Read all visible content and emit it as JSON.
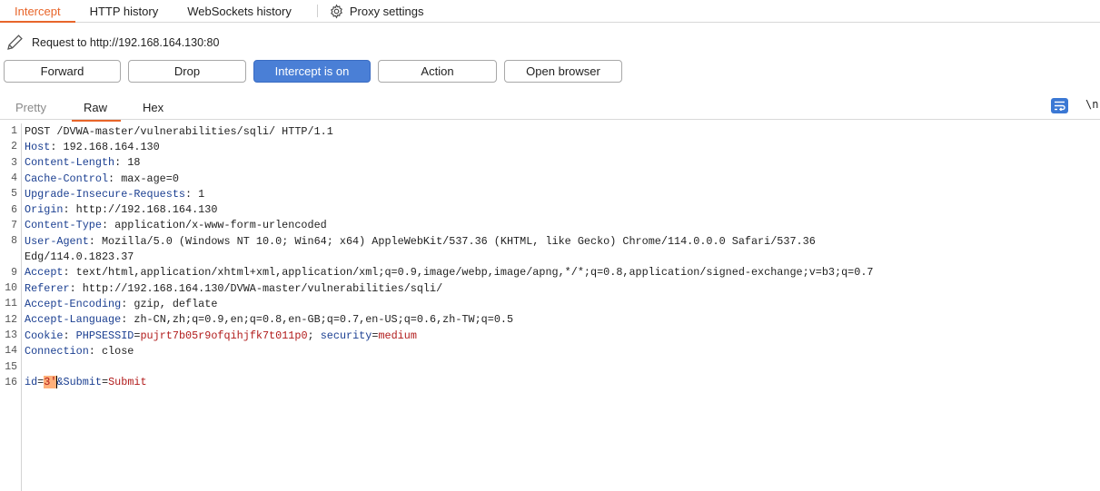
{
  "tabs": {
    "intercept": "Intercept",
    "http_history": "HTTP history",
    "websockets_history": "WebSockets history",
    "proxy_settings": "Proxy settings"
  },
  "request_to": "Request to http://192.168.164.130:80",
  "buttons": {
    "forward": "Forward",
    "drop": "Drop",
    "intercept": "Intercept is on",
    "action": "Action",
    "open_browser": "Open browser"
  },
  "editor_tabs": {
    "pretty": "Pretty",
    "raw": "Raw",
    "hex": "Hex",
    "newline": "\\n"
  },
  "colors": {
    "accent": "#e8652a",
    "intercept_on": "#4a7fd6",
    "header_name": "#1b3f91",
    "value_red": "#b11b1b",
    "highlight": "#ffb07a"
  },
  "request": {
    "request_line": "POST /DVWA-master/vulnerabilities/sqli/ HTTP/1.1",
    "headers": [
      {
        "name": "Host",
        "value": "192.168.164.130"
      },
      {
        "name": "Content-Length",
        "value": "18"
      },
      {
        "name": "Cache-Control",
        "value": "max-age=0"
      },
      {
        "name": "Upgrade-Insecure-Requests",
        "value": "1"
      },
      {
        "name": "Origin",
        "value": "http://192.168.164.130"
      },
      {
        "name": "Content-Type",
        "value": "application/x-www-form-urlencoded"
      },
      {
        "name": "User-Agent",
        "value": "Mozilla/5.0 (Windows NT 10.0; Win64; x64) AppleWebKit/537.36 (KHTML, like Gecko) Chrome/114.0.0.0 Safari/537.36",
        "cont": "Edg/114.0.1823.37"
      },
      {
        "name": "Accept",
        "value": "text/html,application/xhtml+xml,application/xml;q=0.9,image/webp,image/apng,*/*;q=0.8,application/signed-exchange;v=b3;q=0.7"
      },
      {
        "name": "Referer",
        "value": "http://192.168.164.130/DVWA-master/vulnerabilities/sqli/"
      },
      {
        "name": "Accept-Encoding",
        "value": "gzip, deflate"
      },
      {
        "name": "Accept-Language",
        "value": "zh-CN,zh;q=0.9,en;q=0.8,en-GB;q=0.7,en-US;q=0.6,zh-TW;q=0.5"
      }
    ],
    "cookie": {
      "name": "Cookie",
      "phpsessid_key": "PHPSESSID",
      "phpsessid_value": "pujrt7b05r9ofqihjfk7t011p0",
      "security_key": "security",
      "security_value": "medium"
    },
    "connection": {
      "name": "Connection",
      "value": "close"
    },
    "body": {
      "id_key": "id",
      "id_value": "3'",
      "submit_key": "&Submit",
      "submit_value": "Submit"
    }
  },
  "line_numbers": [
    "1",
    "2",
    "3",
    "4",
    "5",
    "6",
    "7",
    "8",
    "9",
    "10",
    "11",
    "12",
    "13",
    "14",
    "15",
    "16"
  ]
}
